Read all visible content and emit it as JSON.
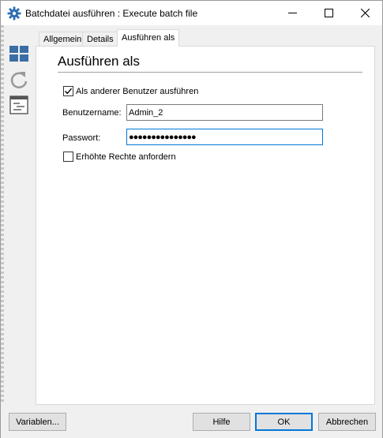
{
  "window": {
    "title": "Batchdatei ausführen : Execute batch file",
    "icon": "gear-icon"
  },
  "titlebar_buttons": {
    "minimize": "minimize-icon",
    "maximize": "maximize-icon",
    "close": "close-icon"
  },
  "sidebar": {
    "icons": [
      "windows-grid-icon",
      "refresh-icon",
      "properties-list-icon"
    ]
  },
  "tabs": [
    {
      "label": "Allgemein",
      "active": false
    },
    {
      "label": "Details",
      "active": false
    },
    {
      "label": "Ausführen als",
      "active": true
    }
  ],
  "panel": {
    "title": "Ausführen als",
    "run_as_other_user": {
      "label": "Als anderer Benutzer ausführen",
      "checked": true
    },
    "username": {
      "label": "Benutzername:",
      "value": "Admin_2"
    },
    "password": {
      "label": "Passwort:",
      "value": "●●●●●●●●●●●●●●●"
    },
    "elevated": {
      "label": "Erhöhte Rechte anfordern",
      "checked": false
    }
  },
  "buttons": {
    "variables": "Variablen...",
    "help": "Hilfe",
    "ok": "OK",
    "cancel": "Abbrechen"
  },
  "colors": {
    "accent": "#0078d7",
    "window_bg": "#f0f0f0",
    "icon_blue": "#3a6ea5"
  }
}
